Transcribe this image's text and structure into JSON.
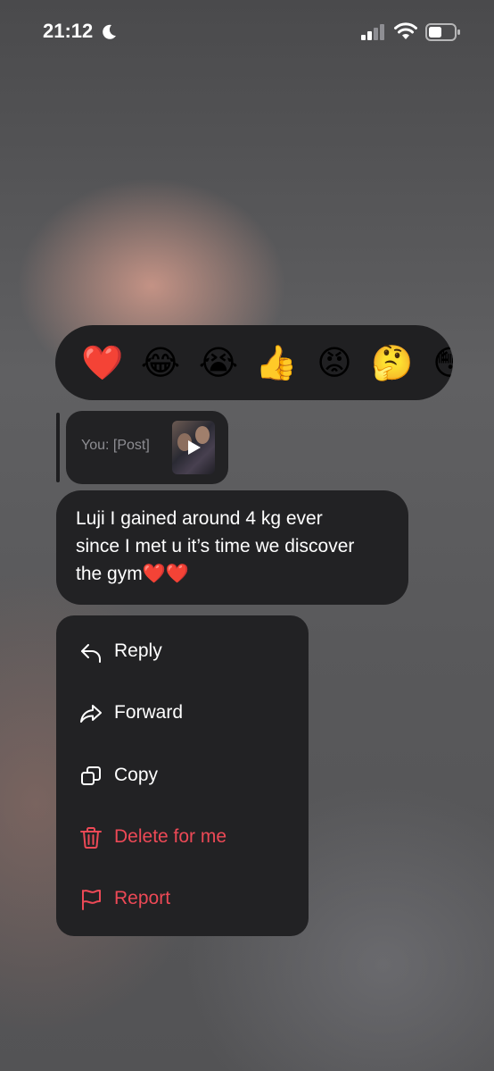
{
  "status_bar": {
    "time": "21:12",
    "icons": [
      "moon-icon",
      "signal-icon",
      "wifi-icon",
      "battery-icon"
    ]
  },
  "reactions": [
    "❤️",
    "😂",
    "😭",
    "👍",
    "😡",
    "🤔",
    "😳"
  ],
  "reply_preview": {
    "text": "You: [Post]"
  },
  "message": {
    "text": "Luji I gained around 4 kg ever\nsince I met u it’s time we discover\nthe gym❤️❤️"
  },
  "menu": {
    "items": [
      {
        "label": "Reply",
        "icon": "reply-icon",
        "color": "#ffffff"
      },
      {
        "label": "Forward",
        "icon": "forward-icon",
        "color": "#ffffff"
      },
      {
        "label": "Copy",
        "icon": "copy-icon",
        "color": "#ffffff"
      },
      {
        "label": "Delete for me",
        "icon": "trash-icon",
        "color": "#ed4956"
      },
      {
        "label": "Report",
        "icon": "flag-icon",
        "color": "#ed4956"
      }
    ]
  },
  "colors": {
    "bubble": "#222224",
    "destructive": "#ed4956"
  }
}
